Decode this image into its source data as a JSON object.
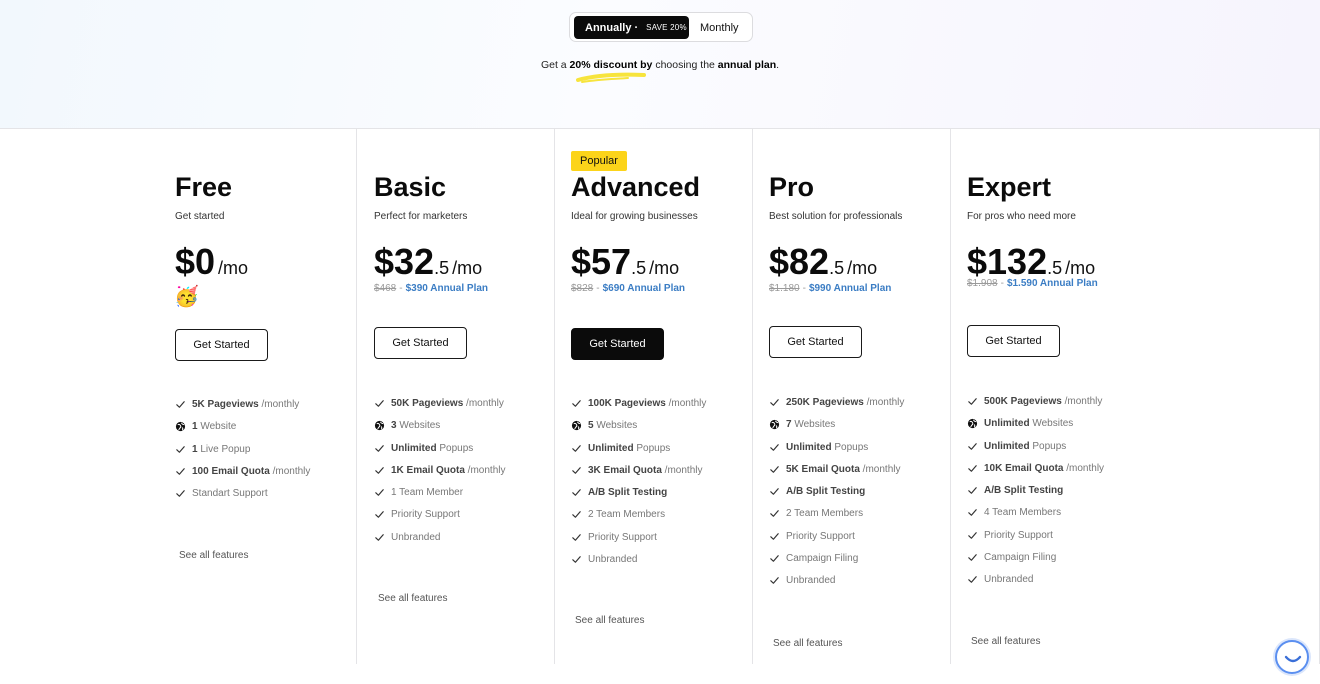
{
  "billing": {
    "annual_label": "Annually ·",
    "save_badge": "SAVE 20%",
    "monthly_label": "Monthly",
    "discount_note": {
      "prefix": "Get a ",
      "bold1": "20% discount by",
      "middle": " choosing the ",
      "bold2": "annual plan",
      "suffix": "."
    }
  },
  "colors": {
    "accent_blue": "#3b7dc4",
    "badge_yellow": "#fcd41a",
    "dark": "#0b0b0b"
  },
  "plans": [
    {
      "name": "Free",
      "tagline": "Get started",
      "price_main": "$0",
      "price_decimal": "",
      "price_unit": "/mo",
      "old_price": "",
      "annual_price": "",
      "emoji": "🥳",
      "cta": "Get Started",
      "features": [
        {
          "icon": "check-icon",
          "highlight": "5K Pageviews",
          "rest": " /monthly"
        },
        {
          "icon": "globe-icon",
          "highlight": "1",
          "rest": " Website"
        },
        {
          "icon": "check-icon",
          "highlight": "1",
          "rest": " Live Popup"
        },
        {
          "icon": "check-icon",
          "highlight": "100 Email Quota",
          "rest": " /monthly"
        },
        {
          "icon": "check-icon",
          "highlight": "",
          "rest": "Standart Support"
        }
      ],
      "see_all": "See all features"
    },
    {
      "name": "Basic",
      "tagline": "Perfect for marketers",
      "price_main": "$32",
      "price_decimal": ".5",
      "price_unit": "/mo",
      "old_price": "$468",
      "annual_price": "$390 Annual Plan",
      "cta": "Get Started",
      "features": [
        {
          "icon": "check-icon",
          "highlight": "50K Pageviews",
          "rest": " /monthly"
        },
        {
          "icon": "globe-icon",
          "highlight": "3",
          "rest": " Websites"
        },
        {
          "icon": "check-icon",
          "highlight": "Unlimited",
          "rest": " Popups"
        },
        {
          "icon": "check-icon",
          "highlight": "1K Email Quota",
          "rest": " /monthly"
        },
        {
          "icon": "check-icon",
          "highlight": "",
          "rest": "1 Team Member"
        },
        {
          "icon": "check-icon",
          "highlight": "",
          "rest": "Priority Support"
        },
        {
          "icon": "check-icon",
          "highlight": "",
          "rest": "Unbranded"
        }
      ],
      "see_all": "See all features"
    },
    {
      "name": "Advanced",
      "badge": "Popular",
      "tagline": "Ideal for growing businesses",
      "price_main": "$57",
      "price_decimal": ".5",
      "price_unit": "/mo",
      "old_price": "$828",
      "annual_price": "$690 Annual Plan",
      "cta": "Get Started",
      "features": [
        {
          "icon": "check-icon",
          "highlight": "100K Pageviews",
          "rest": " /monthly"
        },
        {
          "icon": "globe-icon",
          "highlight": "5",
          "rest": " Websites"
        },
        {
          "icon": "check-icon",
          "highlight": "Unlimited",
          "rest": " Popups"
        },
        {
          "icon": "check-icon",
          "highlight": "3K Email Quota",
          "rest": " /monthly"
        },
        {
          "icon": "check-icon",
          "highlight": "A/B Split Testing",
          "rest": ""
        },
        {
          "icon": "check-icon",
          "highlight": "",
          "rest": "2 Team Members"
        },
        {
          "icon": "check-icon",
          "highlight": "",
          "rest": "Priority Support"
        },
        {
          "icon": "check-icon",
          "highlight": "",
          "rest": "Unbranded"
        }
      ],
      "see_all": "See all features"
    },
    {
      "name": "Pro",
      "tagline": "Best solution for professionals",
      "price_main": "$82",
      "price_decimal": ".5",
      "price_unit": "/mo",
      "old_price": "$1.180",
      "annual_price": "$990 Annual Plan",
      "cta": "Get Started",
      "features": [
        {
          "icon": "check-icon",
          "highlight": "250K Pageviews",
          "rest": " /monthly"
        },
        {
          "icon": "globe-icon",
          "highlight": "7",
          "rest": " Websites"
        },
        {
          "icon": "check-icon",
          "highlight": "Unlimited",
          "rest": " Popups"
        },
        {
          "icon": "check-icon",
          "highlight": "5K Email Quota",
          "rest": " /monthly"
        },
        {
          "icon": "check-icon",
          "highlight": "A/B Split Testing",
          "rest": ""
        },
        {
          "icon": "check-icon",
          "highlight": "",
          "rest": "2 Team Members"
        },
        {
          "icon": "check-icon",
          "highlight": "",
          "rest": "Priority Support"
        },
        {
          "icon": "check-icon",
          "highlight": "",
          "rest": "Campaign Filing"
        },
        {
          "icon": "check-icon",
          "highlight": "",
          "rest": "Unbranded"
        }
      ],
      "see_all": "See all features"
    },
    {
      "name": "Expert",
      "tagline": "For pros who need more",
      "price_main": "$132",
      "price_decimal": ".5",
      "price_unit": "/mo",
      "old_price": "$1.908",
      "annual_price": "$1.590 Annual Plan",
      "cta": "Get Started",
      "features": [
        {
          "icon": "check-icon",
          "highlight": "500K Pageviews",
          "rest": " /monthly"
        },
        {
          "icon": "globe-icon",
          "highlight": "Unlimited",
          "rest": " Websites"
        },
        {
          "icon": "check-icon",
          "highlight": "Unlimited",
          "rest": " Popups"
        },
        {
          "icon": "check-icon",
          "highlight": "10K Email Quota",
          "rest": " /monthly"
        },
        {
          "icon": "check-icon",
          "highlight": "A/B Split Testing",
          "rest": ""
        },
        {
          "icon": "check-icon",
          "highlight": "",
          "rest": "4 Team Members"
        },
        {
          "icon": "check-icon",
          "highlight": "",
          "rest": "Priority Support"
        },
        {
          "icon": "check-icon",
          "highlight": "",
          "rest": "Campaign Filing"
        },
        {
          "icon": "check-icon",
          "highlight": "",
          "rest": "Unbranded"
        }
      ],
      "see_all": "See all features"
    }
  ]
}
